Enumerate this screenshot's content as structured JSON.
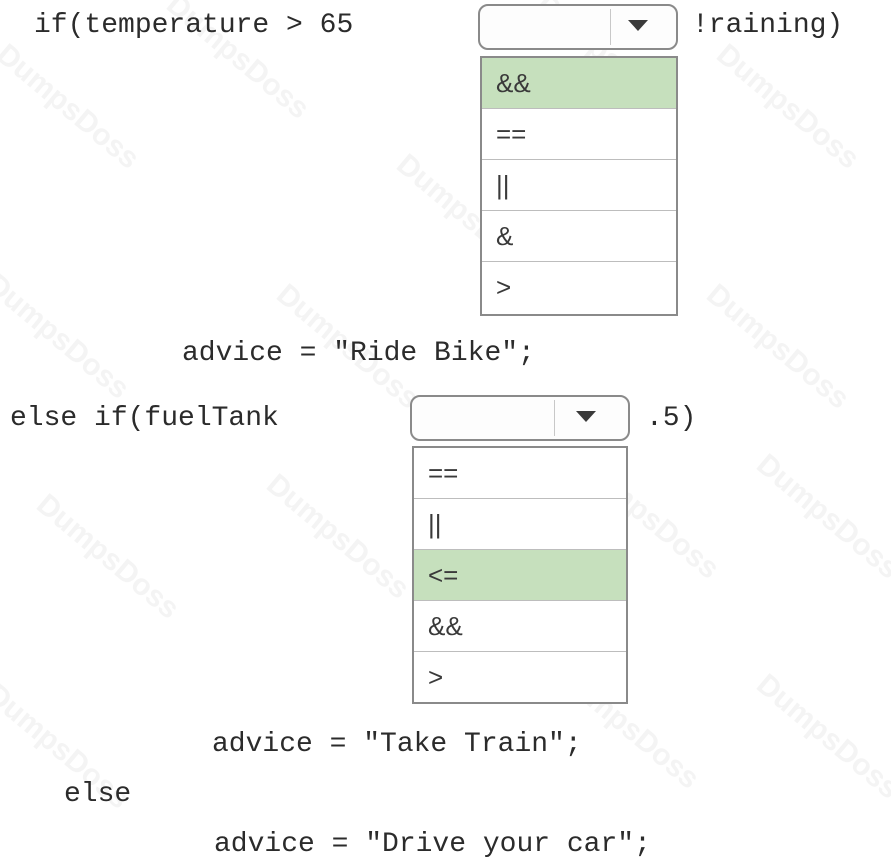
{
  "watermark": "DumpsDoss",
  "code": {
    "line1_prefix": "if(temperature > 65",
    "line1_suffix": "!raining)",
    "line2": "advice = \"Ride Bike\";",
    "line3_prefix": "else if(fuelTank",
    "line3_suffix": ".5)",
    "line4": "advice = \"Take Train\";",
    "line5": "else",
    "line6": "advice = \"Drive your car\";"
  },
  "dropdown1": {
    "value": "",
    "options": [
      "&&",
      "==",
      "||",
      "&",
      ">"
    ],
    "highlighted": "&&"
  },
  "dropdown2": {
    "value": "",
    "options": [
      "==",
      "||",
      "<=",
      "&&",
      ">"
    ],
    "highlighted": "<="
  },
  "colors": {
    "highlight": "#c6e0bd",
    "border": "#8a8a8a",
    "text": "#2b2b2b"
  }
}
